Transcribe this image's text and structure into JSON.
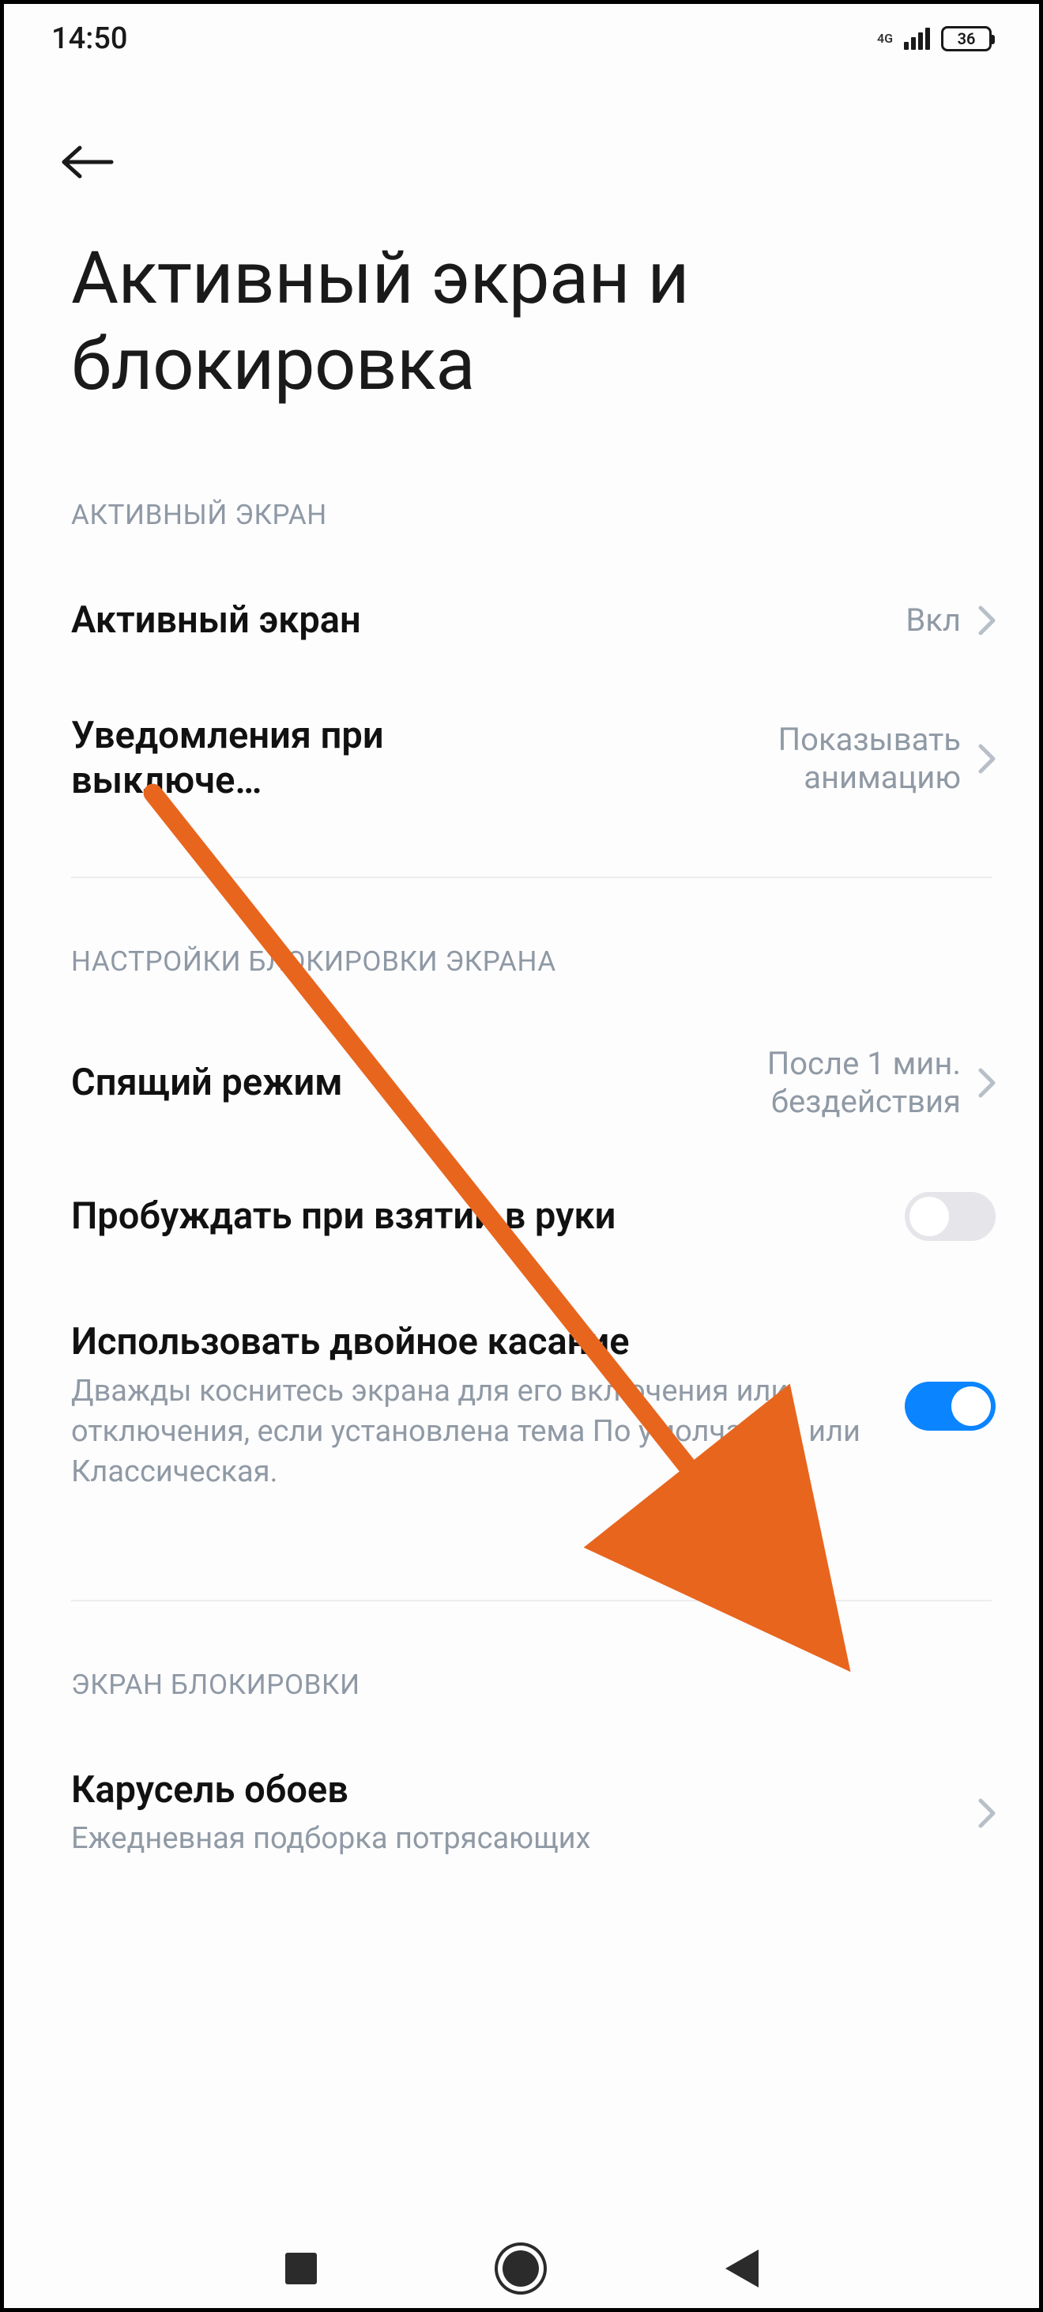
{
  "status": {
    "time": "14:50",
    "network": "4G",
    "battery": "36"
  },
  "page": {
    "title": "Активный экран и блокировка"
  },
  "sections": {
    "active_display": {
      "header": "АКТИВНЫЙ ЭКРАН",
      "rows": {
        "active_display": {
          "title": "Активный экран",
          "value": "Вкл"
        },
        "notifications_off": {
          "title": "Уведомления при выключе…",
          "value": "Показывать анимацию"
        }
      }
    },
    "lock_settings": {
      "header": "НАСТРОЙКИ БЛОКИРОВКИ ЭКРАНА",
      "rows": {
        "sleep_mode": {
          "title": "Спящий режим",
          "value": "После 1 мин. бездействия"
        },
        "raise_to_wake": {
          "title": "Пробуждать при взятии в руки",
          "toggle": false
        },
        "double_tap": {
          "title": "Использовать двойное касание",
          "desc": "Дважды коснитесь экрана для его включения или отключения, если установлена тема По умолчанию или Классическая.",
          "toggle": true
        }
      }
    },
    "lock_screen": {
      "header": "ЭКРАН БЛОКИРОВКИ",
      "rows": {
        "wallpaper_carousel": {
          "title": "Карусель обоев",
          "desc": "Ежедневная подборка потрясающих"
        }
      }
    }
  },
  "colors": {
    "accent": "#0a84ff",
    "arrow": "#e8651e"
  }
}
